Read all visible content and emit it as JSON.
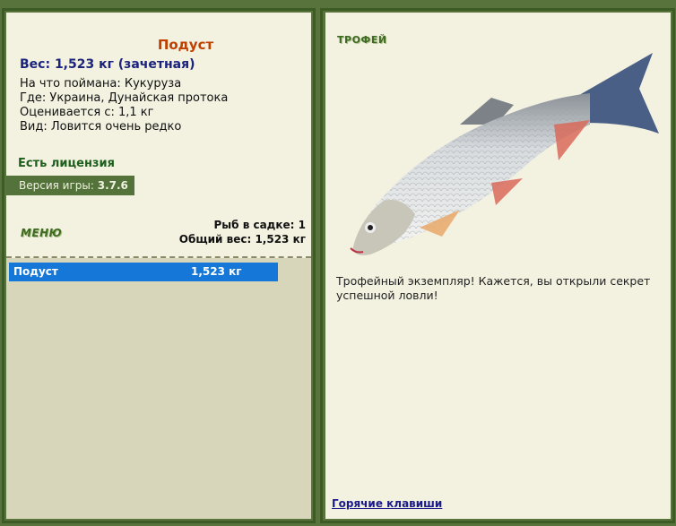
{
  "catch": {
    "fish_name": "Подуст",
    "weight_line": "Вес: 1,523 кг (зачетная)",
    "bait_line": "На что поймана: Кукуруза",
    "where_line": "Где: Украина, Дунайская протока",
    "rated_line": "Оценивается с: 1,1 кг",
    "kind_line": "Вид: Ловится очень редко"
  },
  "license": "Есть лицензия",
  "version": {
    "label": "Версия игры:",
    "value": "3.7.6"
  },
  "menu": {
    "title": "МЕНЮ"
  },
  "keepnet": {
    "fish_count": "Рыб в садке: 1",
    "total_weight": "Общий вес: 1,523 кг",
    "rows": [
      {
        "name": "Подуст",
        "weight": "1,523 кг"
      }
    ]
  },
  "trophy": {
    "title": "ТРОФЕЙ",
    "message": "Трофейный экземпляр! Кажется, вы открыли секрет успешной ловли!"
  },
  "hotkeys_link": "Горячие клавиши",
  "colors": {
    "frame": "#3d5b25",
    "panel": "#f3f1e0",
    "selected_row": "#1578d8",
    "fish_name": "#c04000"
  },
  "icons": {
    "fish_image": "fish-photo-icon"
  }
}
